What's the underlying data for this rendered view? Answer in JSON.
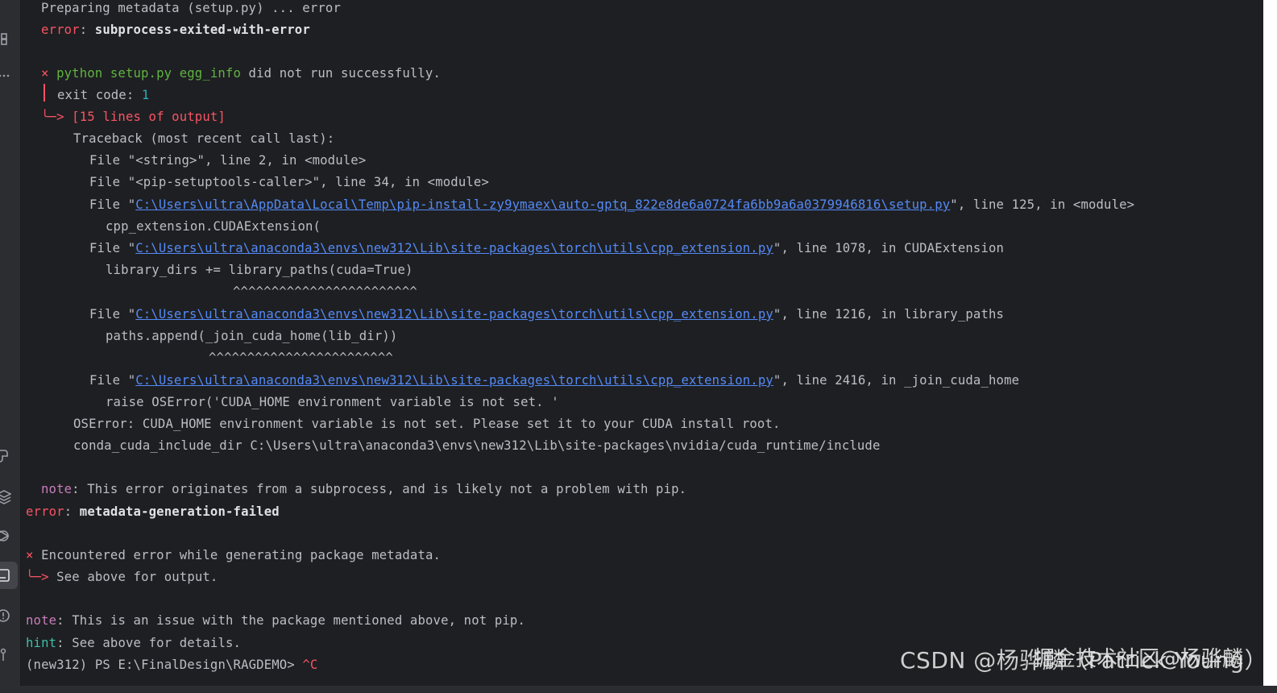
{
  "terminal": {
    "l1": "Preparing metadata (setup.py) ... error",
    "l2_label": "error",
    "l2_text": "subprocess-exited-with-error",
    "l3_mark": "×",
    "l3_cmd": "python setup.py egg_info",
    "l3_rest": " did not run successfully.",
    "l4_label": "exit code: ",
    "l4_code": "1",
    "l5_arrow": "╰─>",
    "l5_text": "[15 lines of output]",
    "l6": "Traceback (most recent call last):",
    "l7": "File \"<string>\", line 2, in <module>",
    "l8": "File \"<pip-setuptools-caller>\", line 34, in <module>",
    "l9_pre": "File \"",
    "l9_link": "C:\\Users\\ultra\\AppData\\Local\\Temp\\pip-install-zy9ymaex\\auto-gptq_822e8de6a0724fa6bb9a6a0379946816\\setup.py",
    "l9_post": "\", line 125, in <module>",
    "l10": "cpp_extension.CUDAExtension(",
    "l11_pre": "File \"",
    "l11_link": "C:\\Users\\ultra\\anaconda3\\envs\\new312\\Lib\\site-packages\\torch\\utils\\cpp_extension.py",
    "l11_post": "\", line 1078, in CUDAExtension",
    "l12": "library_dirs += library_paths(cuda=True)",
    "l13": "^^^^^^^^^^^^^^^^^^^^^^^^",
    "l14_pre": "File \"",
    "l14_link": "C:\\Users\\ultra\\anaconda3\\envs\\new312\\Lib\\site-packages\\torch\\utils\\cpp_extension.py",
    "l14_post": "\", line 1216, in library_paths",
    "l15": "paths.append(_join_cuda_home(lib_dir))",
    "l16": "^^^^^^^^^^^^^^^^^^^^^^^^",
    "l17_pre": "File \"",
    "l17_link": "C:\\Users\\ultra\\anaconda3\\envs\\new312\\Lib\\site-packages\\torch\\utils\\cpp_extension.py",
    "l17_post": "\", line 2416, in _join_cuda_home",
    "l18": "raise OSError('CUDA_HOME environment variable is not set. '",
    "l19": "OSError: CUDA_HOME environment variable is not set. Please set it to your CUDA install root.",
    "l20": "conda_cuda_include_dir C:\\Users\\ultra\\anaconda3\\envs\\new312\\Lib\\site-packages\\nvidia/cuda_runtime/include",
    "l21_label": "note",
    "l21_text": ": This error originates from a subprocess, and is likely not a problem with pip.",
    "l22_label": "error",
    "l22_text": "metadata-generation-failed",
    "l23_mark": "×",
    "l23_text": " Encountered error while generating package metadata.",
    "l24_arrow": "╰─>",
    "l24_text": " See above for output.",
    "l25_label": "note",
    "l25_text": ": This is an issue with the package mentioned above, not pip.",
    "l26_label": "hint",
    "l26_text": ": See above for details.",
    "l27_prompt": "(new312) PS E:\\FinalDesign\\RAGDEMO> ",
    "l27_ctrl": "^C"
  },
  "watermark": {
    "csdn": "CSDN @杨骅麟（Patrick Young）",
    "juejin": "掘金技术社区@杨骅麟"
  },
  "colors": {
    "background": "#1e1f22",
    "error": "#f75464",
    "link": "#548af7",
    "green": "#5fb441",
    "note": "#c77dbb"
  }
}
